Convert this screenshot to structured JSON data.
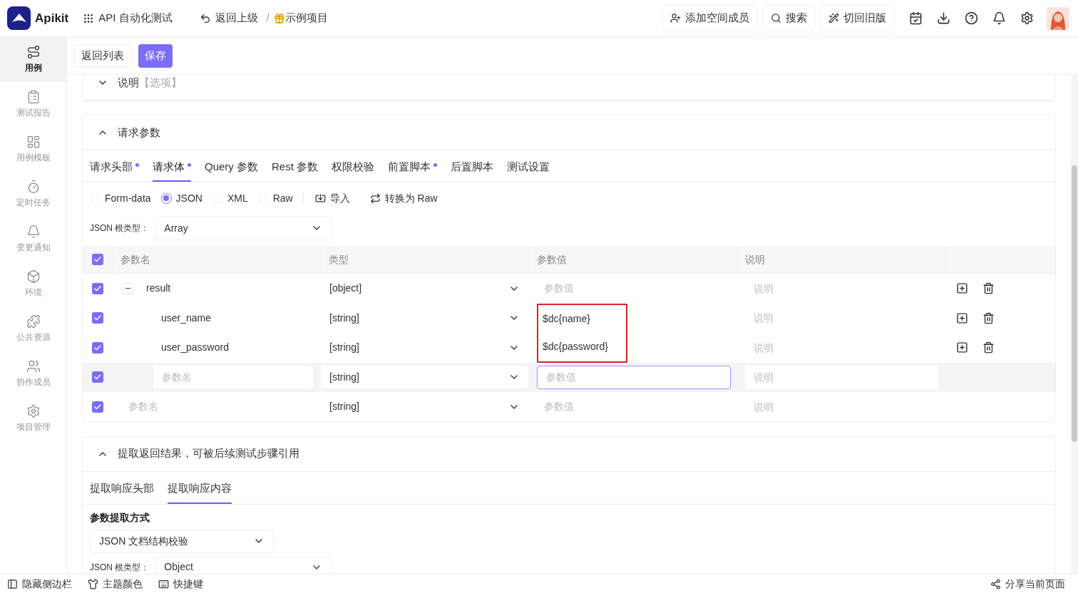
{
  "header": {
    "logo": "Apikit",
    "app_menu": "API 自动化测试",
    "back": "返回上级",
    "separator": "/",
    "project": "示例项目",
    "buttons": [
      "添加空间成员",
      "搜索",
      "切回旧版"
    ]
  },
  "sidebar": {
    "items": [
      {
        "label": "用例",
        "selected": true
      },
      {
        "label": "测试报告",
        "selected": false
      },
      {
        "label": "用例模板",
        "selected": false
      },
      {
        "label": "定时任务",
        "selected": false
      },
      {
        "label": "变更通知",
        "selected": false
      },
      {
        "label": "环境",
        "selected": false
      },
      {
        "label": "公共资源",
        "selected": false
      },
      {
        "label": "协作成员",
        "selected": false
      },
      {
        "label": "项目管理",
        "selected": false
      }
    ]
  },
  "toolbar": {
    "buttons": [
      {
        "label": "返回列表",
        "kind": "default"
      },
      {
        "label": "保存",
        "kind": "primary"
      }
    ]
  },
  "description": {
    "title": "说明",
    "hint": "【选项】",
    "expanded": false
  },
  "request_params": {
    "title": "请求参数",
    "expanded": true,
    "tabs": [
      {
        "label": "请求头部",
        "selected": false,
        "dot": true
      },
      {
        "label": "请求体",
        "selected": true,
        "dot": true
      },
      {
        "label": "Query 参数",
        "selected": false,
        "dot": false
      },
      {
        "label": "Rest 参数",
        "selected": false,
        "dot": false
      },
      {
        "label": "权限校验",
        "selected": false,
        "dot": false
      },
      {
        "label": "前置脚本",
        "selected": false,
        "dot": true
      },
      {
        "label": "后置脚本",
        "selected": false,
        "dot": false
      },
      {
        "label": "测试设置",
        "selected": false,
        "dot": false
      }
    ],
    "body_types": [
      {
        "label": "Form-data",
        "selected": false
      },
      {
        "label": "JSON",
        "selected": true
      },
      {
        "label": "XML",
        "selected": false
      },
      {
        "label": "Raw",
        "selected": false
      }
    ],
    "actions": [
      "导入",
      "转换为 Raw"
    ],
    "root_type": {
      "label": "JSON 根类型：",
      "value": "Array"
    },
    "table": {
      "all_checked": true,
      "columns": [
        "参数名",
        "类型",
        "参数值",
        "说明"
      ],
      "rows": [
        {
          "kind": "text",
          "checked": true,
          "name": "result",
          "type": "[object]",
          "value_placeholder": "参数值",
          "note_placeholder": "说明",
          "expanded": true,
          "children": [
            {
              "kind": "text",
              "checked": true,
              "name": "user_name",
              "type": "[string]",
              "value": "$dc{name}",
              "note_placeholder": "说明",
              "highlighted": true
            },
            {
              "kind": "text",
              "checked": true,
              "name": "user_password",
              "type": "[string]",
              "value": "$dc{password}",
              "note_placeholder": "说明",
              "highlighted": true
            }
          ]
        },
        {
          "kind": "field",
          "checked": true,
          "name_placeholder": "参数名",
          "type": "[string]",
          "value_placeholder": "参数值",
          "note_placeholder": "说明",
          "focused": true
        },
        {
          "kind": "new",
          "checked": true,
          "name_placeholder": "参数名",
          "type": "[string]",
          "value_placeholder": "参数值",
          "note_placeholder": "说明"
        }
      ]
    }
  },
  "extract": {
    "title": "提取返回结果，可被后续测试步骤引用",
    "expanded": true,
    "tabs": [
      {
        "label": "提取响应头部",
        "selected": false
      },
      {
        "label": "提取响应内容",
        "selected": true
      }
    ],
    "method_label": "参数提取方式",
    "method": "JSON 文档结构校验",
    "root_type": {
      "label": "JSON 根类型：",
      "value": "Object"
    }
  },
  "footer": {
    "left": [
      "隐藏侧边栏",
      "主题颜色",
      "快捷键"
    ],
    "right": "分享当前页面"
  }
}
